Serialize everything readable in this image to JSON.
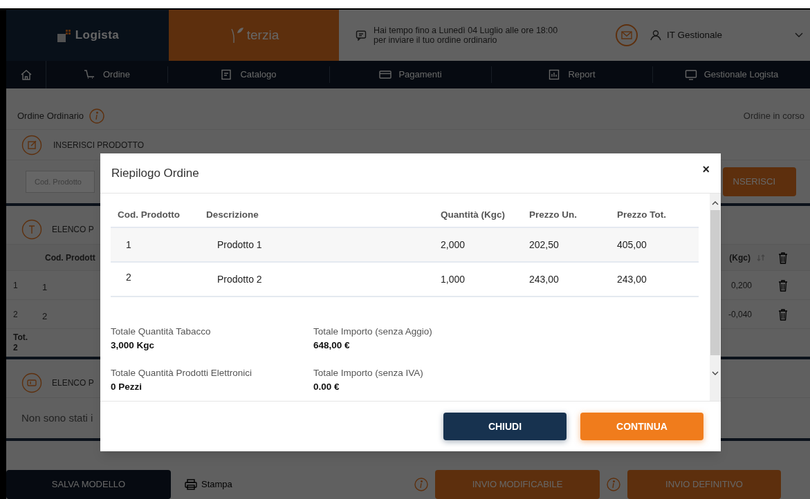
{
  "header": {
    "logo": "Logista",
    "brand": "terzia",
    "message": [
      "Hai tempo fino a Lunedì 04 Luglio alle ore 18:00",
      "per inviare il tuo ordine ordinario"
    ],
    "user": "IT Gestionale"
  },
  "nav": [
    {
      "label": "Ordine"
    },
    {
      "label": "Catalogo"
    },
    {
      "label": "Pagamenti"
    },
    {
      "label": "Report"
    },
    {
      "label": "Gestionale Logista"
    }
  ],
  "order": {
    "title": "Ordine Ordinario",
    "status": "Ordine in corso",
    "insert_title": "INSERISCI PRODOTTO",
    "code_field": {
      "placeholder": "Cod. Prodotto"
    },
    "insert_button": "NSERISCI",
    "list_title": "ELENCO P",
    "columns": [
      "Cod. Prodott",
      "(Kgc)"
    ],
    "rows": [
      {
        "index": "1",
        "code": "1",
        "quantity": "0,200"
      },
      {
        "index": "2",
        "code": "2",
        "quantity": "-0,040"
      }
    ],
    "total_label": "Tot.",
    "total_value": "2",
    "list2_title": "ELENCO P",
    "empty_text": "Non sono stati i"
  },
  "footer": {
    "save": "SALVA MODELLO",
    "print": "Stampa",
    "buttons": [
      "INVIO MODIFICABILE",
      "INVIO DEFINITIVO"
    ]
  },
  "modal": {
    "title": "Riepilogo Ordine",
    "close": "×",
    "columns": [
      "Cod. Prodotto",
      "Descrizione",
      "Quantità (Kgc)",
      "Prezzo Un.",
      "Prezzo Tot."
    ],
    "rows": [
      [
        "1",
        "Prodotto 1",
        "2,000",
        "202,50",
        "405,00"
      ],
      [
        "2",
        "Prodotto 2",
        "1,000",
        "243,00",
        "243,00"
      ]
    ],
    "totals": [
      {
        "label": "Totale Quantità Tabacco",
        "value": "3,000 Kgc"
      },
      {
        "label": "Totale Importo (senza Aggio)",
        "value": "648,00 €"
      },
      {
        "label": "Totale Quantità Prodotti Elettronici",
        "value": "0 Pezzi"
      },
      {
        "label": "Totale Importo (senza IVA)",
        "value": "0.00 €"
      }
    ],
    "buttons": [
      {
        "label": "CHIUDI",
        "kind": "secondary"
      },
      {
        "label": "CONTINUA",
        "kind": "primary"
      }
    ]
  }
}
